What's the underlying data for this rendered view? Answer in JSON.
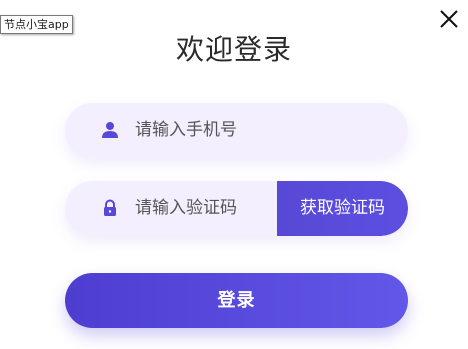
{
  "tooltip": {
    "text": "节点小宝app"
  },
  "header": {
    "title": "欢迎登录",
    "close_icon": "close-icon"
  },
  "form": {
    "phone": {
      "icon": "user-icon",
      "placeholder": "请输入手机号"
    },
    "code": {
      "icon": "lock-icon",
      "placeholder": "请输入验证码",
      "get_code_label": "获取验证码"
    },
    "login_label": "登录"
  },
  "colors": {
    "accent": "#5848d6",
    "field_bg": "#f4efff"
  }
}
